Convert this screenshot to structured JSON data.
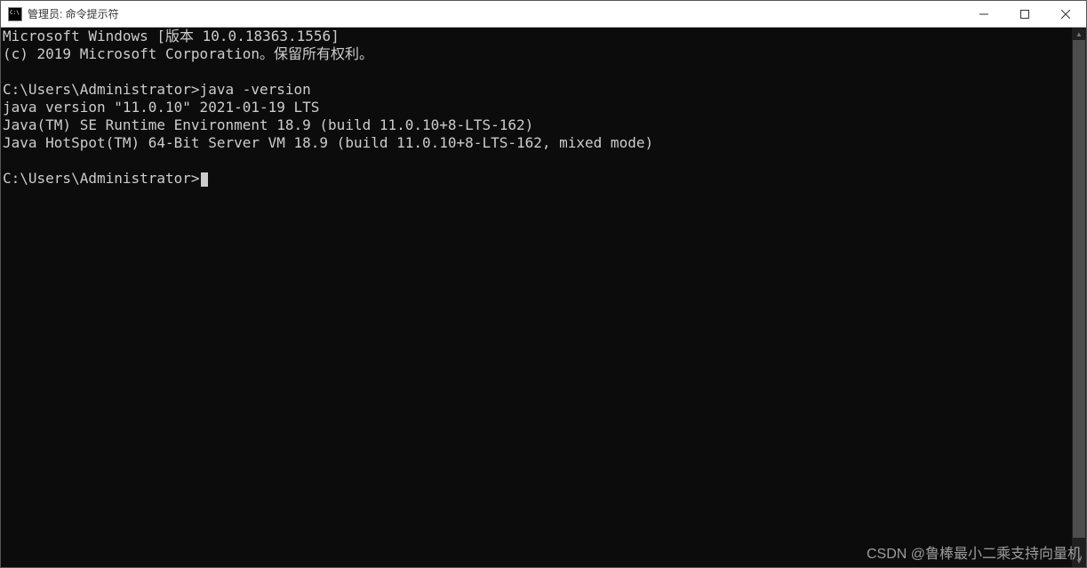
{
  "window": {
    "title": "管理员: 命令提示符"
  },
  "terminal": {
    "lines": [
      "Microsoft Windows [版本 10.0.18363.1556]",
      "(c) 2019 Microsoft Corporation。保留所有权利。",
      "",
      "C:\\Users\\Administrator>java -version",
      "java version \"11.0.10\" 2021-01-19 LTS",
      "Java(TM) SE Runtime Environment 18.9 (build 11.0.10+8-LTS-162)",
      "Java HotSpot(TM) 64-Bit Server VM 18.9 (build 11.0.10+8-LTS-162, mixed mode)",
      "",
      "C:\\Users\\Administrator>"
    ],
    "prompt": "C:\\Users\\Administrator>",
    "last_command": "java -version"
  },
  "watermark": "CSDN @鲁棒最小二乘支持向量机"
}
